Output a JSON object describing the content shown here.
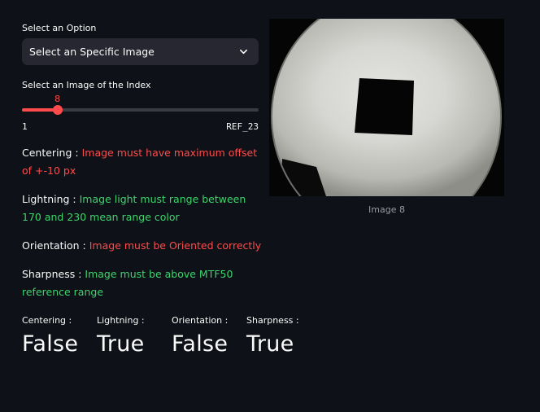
{
  "select": {
    "label": "Select an Option",
    "value": "Select an Specific Image"
  },
  "slider": {
    "label": "Select an Image of the Index",
    "value": "8",
    "min_label": "1",
    "max_label": "REF_23",
    "fill_fraction": 0.15
  },
  "criteria": [
    {
      "name": "Centering :",
      "message": "Image must have maximum offset of +-10 px",
      "status": "fail"
    },
    {
      "name": "Lightning :",
      "message": "Image light must range between 170 and 230 mean range color",
      "status": "pass"
    },
    {
      "name": "Orientation :",
      "message": "Image must be Oriented correctly",
      "status": "fail"
    },
    {
      "name": "Sharpness :",
      "message": "Image must be above MTF50 reference range",
      "status": "pass"
    }
  ],
  "metrics": [
    {
      "label": "Centering :",
      "value": "False"
    },
    {
      "label": "Lightning :",
      "value": "True"
    },
    {
      "label": "Orientation :",
      "value": "False"
    },
    {
      "label": "Sharpness :",
      "value": "True"
    }
  ],
  "image": {
    "caption": "Image 8"
  },
  "colors": {
    "background": "#0e1117",
    "accent": "#ff4b4b",
    "pass": "#3dd56d",
    "fail": "#ff4b4b"
  }
}
